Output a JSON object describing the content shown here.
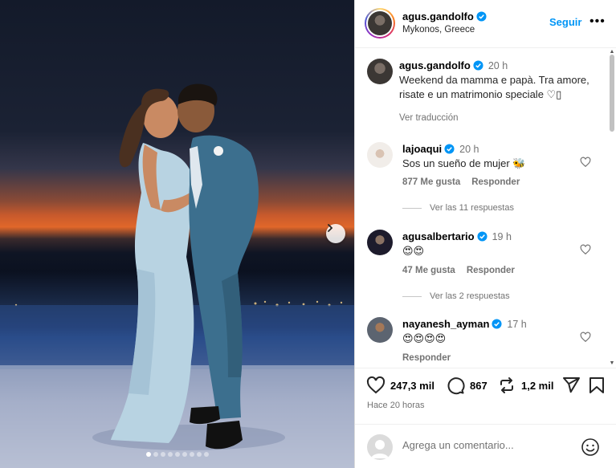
{
  "post": {
    "author": "agus.gandolfo",
    "location": "Mykonos, Greece",
    "follow_label": "Seguir",
    "more_label": "•••",
    "carousel": {
      "slide_count": 9,
      "active_index": 0
    }
  },
  "caption": {
    "author": "agus.gandolfo",
    "time": "20 h",
    "text": "Weekend da mamma e papà. Tra amore, risate e un matrimonio speciale ♡▯",
    "translate_label": "Ver traducción"
  },
  "comments": [
    {
      "author": "lajoaqui",
      "verified": true,
      "time": "20 h",
      "text": "Sos un sueño de mujer 🐝",
      "likes": "877 Me gusta",
      "reply_label": "Responder",
      "replies_label": "Ver las 11 respuestas"
    },
    {
      "author": "agusalbertario",
      "verified": true,
      "time": "19 h",
      "text": "😍😍",
      "likes": "47 Me gusta",
      "reply_label": "Responder",
      "replies_label": "Ver las 2 respuestas"
    },
    {
      "author": "nayanesh_ayman",
      "verified": true,
      "time": "17 h",
      "text": "😍😍😍😍",
      "likes": "",
      "reply_label": "Responder",
      "replies_label": ""
    }
  ],
  "actions": {
    "likes": "247,3 mil",
    "comments": "867",
    "reposts": "1,2 mil",
    "posted_ago": "Hace 20 horas"
  },
  "add_comment": {
    "placeholder": "Agrega un comentario..."
  },
  "colors": {
    "accent": "#0095f6",
    "verified": "#0095f6",
    "muted": "#737373"
  },
  "icons": [
    "verified-badge-icon",
    "heart-icon",
    "comment-icon",
    "repost-icon",
    "share-icon",
    "bookmark-icon",
    "smile-icon",
    "chevron-right-icon"
  ]
}
